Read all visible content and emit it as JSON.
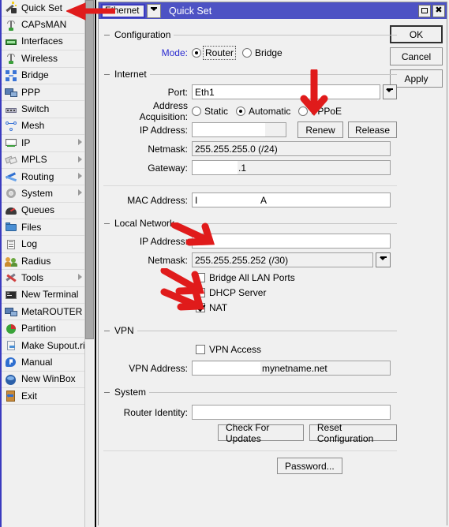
{
  "app": {
    "window_title": "Quick Set",
    "interface_selector_value": "Ethernet",
    "title_restore_glyph": "maximize-restore",
    "title_close_glyph": "✖"
  },
  "sidebar": {
    "items": [
      {
        "label": "Quick Set",
        "icon": "quick-set-icon",
        "submenu": false,
        "selected": true
      },
      {
        "label": "CAPsMAN",
        "icon": "capsman-antenna-icon",
        "submenu": false
      },
      {
        "label": "Interfaces",
        "icon": "interfaces-card-icon",
        "submenu": false
      },
      {
        "label": "Wireless",
        "icon": "wireless-antenna-icon",
        "submenu": false
      },
      {
        "label": "Bridge",
        "icon": "bridge-nodes-icon",
        "submenu": false
      },
      {
        "label": "PPP",
        "icon": "ppp-monitor-icon",
        "submenu": false
      },
      {
        "label": "Switch",
        "icon": "switch-device-icon",
        "submenu": false
      },
      {
        "label": "Mesh",
        "icon": "mesh-nodes-icon",
        "submenu": false
      },
      {
        "label": "IP",
        "icon": "ip-255-icon",
        "submenu": true
      },
      {
        "label": "MPLS",
        "icon": "mpls-tags-icon",
        "submenu": true
      },
      {
        "label": "Routing",
        "icon": "routing-arrows-icon",
        "submenu": true
      },
      {
        "label": "System",
        "icon": "system-gear-icon",
        "submenu": true
      },
      {
        "label": "Queues",
        "icon": "queues-gauge-icon",
        "submenu": false
      },
      {
        "label": "Files",
        "icon": "files-folder-icon",
        "submenu": false
      },
      {
        "label": "Log",
        "icon": "log-list-icon",
        "submenu": false
      },
      {
        "label": "Radius",
        "icon": "radius-users-icon",
        "submenu": false
      },
      {
        "label": "Tools",
        "icon": "tools-wrench-icon",
        "submenu": true
      },
      {
        "label": "New Terminal",
        "icon": "terminal-icon",
        "submenu": false
      },
      {
        "label": "MetaROUTER",
        "icon": "metarouter-icon",
        "submenu": false
      },
      {
        "label": "Partition",
        "icon": "partition-pie-icon",
        "submenu": false
      },
      {
        "label": "Make Supout.rif",
        "icon": "make-supout-file-icon",
        "submenu": false
      },
      {
        "label": "Manual",
        "icon": "manual-help-icon",
        "submenu": false
      },
      {
        "label": "New WinBox",
        "icon": "new-winbox-globe-icon",
        "submenu": false
      },
      {
        "label": "Exit",
        "icon": "exit-door-icon",
        "submenu": false
      }
    ]
  },
  "actions": {
    "ok": "OK",
    "cancel": "Cancel",
    "apply": "Apply"
  },
  "sections": {
    "configuration": {
      "title": "Configuration",
      "mode_label": "Mode:",
      "mode_options": [
        "Router",
        "Bridge"
      ],
      "mode_selected": "Router"
    },
    "internet": {
      "title": "Internet",
      "port_label": "Port:",
      "port_value": "Eth1",
      "address_acquisition_label": "Address Acquisition:",
      "address_acquisition_options": [
        "Static",
        "Automatic",
        "PPPoE"
      ],
      "address_acquisition_selected": "Automatic",
      "ip_address_label": "IP Address:",
      "ip_address_value": "",
      "renew_button": "Renew",
      "release_button": "Release",
      "netmask_label": "Netmask:",
      "netmask_value": "255.255.255.0 (/24)",
      "gateway_label": "Gateway:",
      "gateway_value": ".1",
      "mac_address_label": "MAC Address:",
      "mac_address_value_start": "I",
      "mac_address_value_end": "A"
    },
    "local_network": {
      "title": "Local Network",
      "ip_address_label": "IP Address:",
      "ip_address_value": "",
      "netmask_label": "Netmask:",
      "netmask_value": "255.255.255.252 (/30)",
      "bridge_all_lan_ports_label": "Bridge All LAN Ports",
      "bridge_all_lan_ports_checked": false,
      "dhcp_server_label": "DHCP Server",
      "dhcp_server_checked": false,
      "nat_label": "NAT",
      "nat_checked": true
    },
    "vpn": {
      "title": "VPN",
      "vpn_access_label": "VPN Access",
      "vpn_access_checked": false,
      "vpn_address_label": "VPN Address:",
      "vpn_address_suffix": "mynetname.net"
    },
    "system": {
      "title": "System",
      "router_identity_label": "Router Identity:",
      "router_identity_value": "",
      "check_for_updates_button": "Check For Updates",
      "reset_configuration_button": "Reset Configuration"
    },
    "footer": {
      "password_button": "Password..."
    }
  },
  "annotations": {
    "color": "#e01b1b",
    "arrows": [
      {
        "name": "arrow-to-quick-set",
        "target": "Quick Set sidebar item",
        "direction": "left"
      },
      {
        "name": "arrow-to-pppoe",
        "target": "PPPoE radio",
        "direction": "down"
      },
      {
        "name": "arrow-to-local-network",
        "target": "Local Network group",
        "direction": "down-right"
      },
      {
        "name": "arrow-to-bridge-all-lan-ports",
        "target": "Bridge All LAN Ports checkbox",
        "direction": "down-right"
      },
      {
        "name": "arrow-to-dhcp-server",
        "target": "DHCP Server checkbox",
        "direction": "right"
      }
    ]
  },
  "colors": {
    "titlebar": "#4d52c4",
    "window_bg": "#f0f0f0",
    "accent_blue": "#3b3bbf",
    "label_blue": "#2b2bd0",
    "annotation_red": "#e01b1b"
  }
}
